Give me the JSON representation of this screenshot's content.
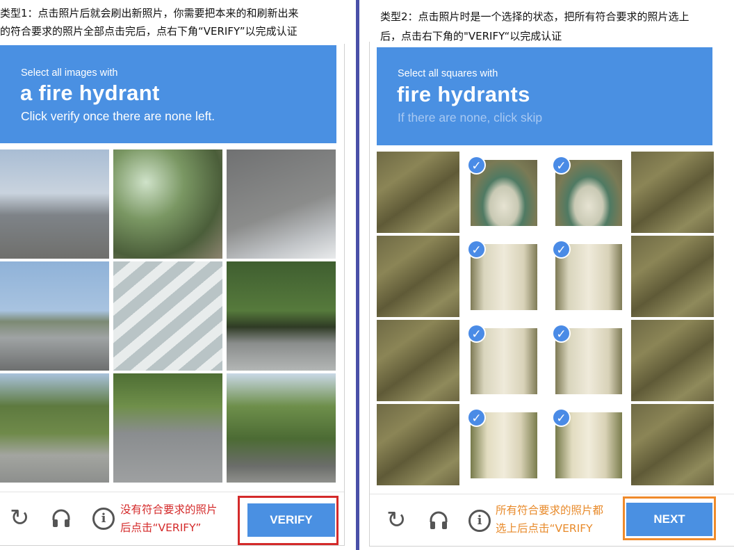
{
  "left_panel": {
    "instruction_line1": "类型1：点击照片后就会刷出新照片，你需要把本来的和刷新出来",
    "instruction_line2": "的符合要求的照片全部点击完后，点右下角“VERIFY”以完成认证",
    "banner": {
      "small": "Select all images with",
      "big": "a fire hydrant",
      "sub": "Click verify once there are none left."
    },
    "hint_line1": "没有符合要求的照片",
    "hint_line2": "后点击“VERIFY”",
    "verify_label": "VERIFY"
  },
  "right_panel": {
    "instruction_line1": "类型2：点击照片时是一个选择的状态，把所有符合要求的照片选上",
    "instruction_line2": "后，点击右下角的\"VERIFY“以完成认证",
    "banner": {
      "small": "Select all squares with",
      "big": "fire hydrants",
      "sub": "If there are none, click skip"
    },
    "hint_line1": "所有符合要求的照片都",
    "hint_line2": "选上后点击“VERIFY",
    "next_label": "NEXT"
  },
  "icons": {
    "reload": "reload-icon",
    "audio": "headphones-icon",
    "info": "info-icon",
    "check": "checkmark-icon"
  },
  "colors": {
    "accent_blue": "#4a90e2",
    "highlight_red": "#d42a2a",
    "highlight_orange": "#f08a2a",
    "divider": "#4a50a8"
  }
}
